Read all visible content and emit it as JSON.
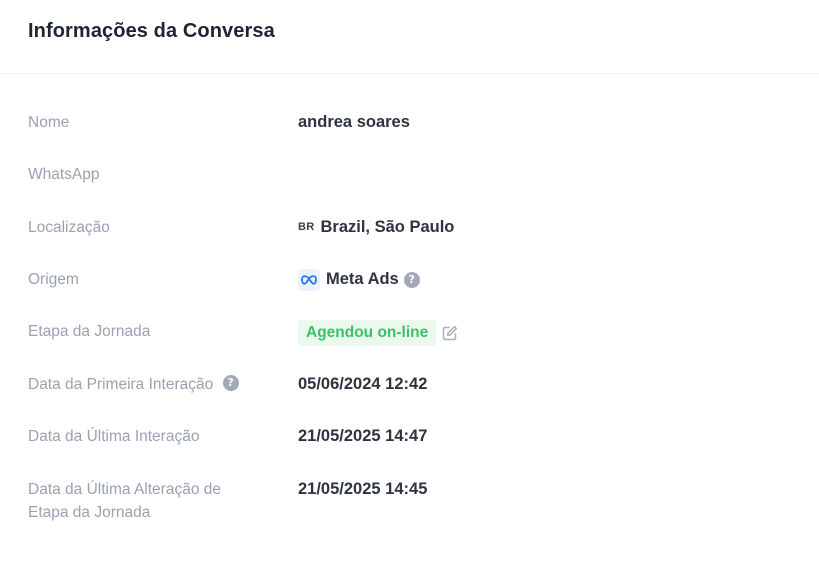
{
  "header": {
    "title": "Informações da Conversa"
  },
  "fields": {
    "nome": {
      "label": "Nome",
      "value": "andrea soares"
    },
    "whatsapp": {
      "label": "WhatsApp",
      "value": ""
    },
    "localizacao": {
      "label": "Localização",
      "flag": "BR",
      "value": "Brazil, São Paulo"
    },
    "origem": {
      "label": "Origem",
      "value": "Meta Ads",
      "icon": "meta-logo-icon"
    },
    "etapa": {
      "label": "Etapa da Jornada",
      "value": "Agendou on-line",
      "badge_bg": "#eaf8ee",
      "badge_color": "#3dbf68"
    },
    "primeira": {
      "label": "Data da Primeira Interação",
      "value": "05/06/2024 12:42"
    },
    "ultima": {
      "label": "Data da Última Interação",
      "value": "21/05/2025 14:47"
    },
    "alteracao": {
      "label": "Data da Última Alteração de Etapa da Jornada",
      "value": "21/05/2025 14:45"
    }
  },
  "icons": {
    "help": "?"
  },
  "colors": {
    "label": "#9aa1b0",
    "value": "#2e3340",
    "meta_blue": "#1877f2"
  }
}
